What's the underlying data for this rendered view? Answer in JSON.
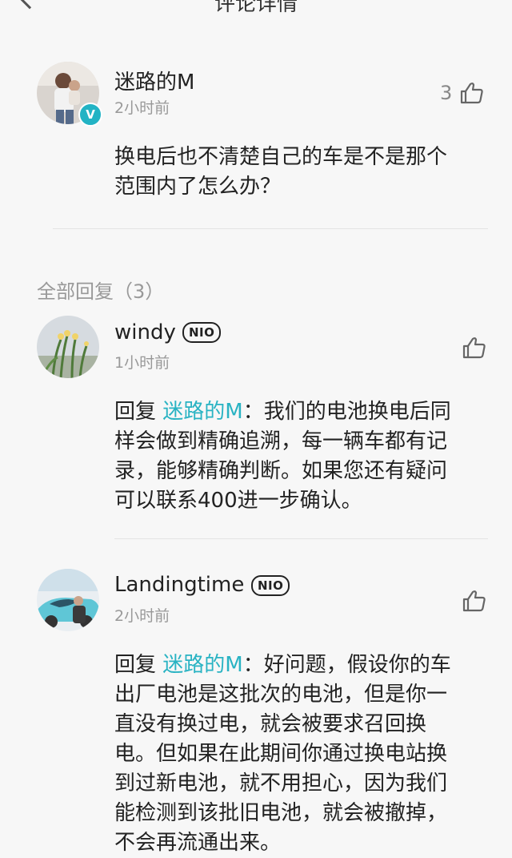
{
  "header": {
    "title": "评论详情"
  },
  "main_comment": {
    "username": "迷路的M",
    "time": "2小时前",
    "like_count": "3",
    "content": "换电后也不清楚自己的车是不是那个\n范围内了怎么办？",
    "verified_badge": "V"
  },
  "replies_section": {
    "label": "全部回复（3）"
  },
  "replies": [
    {
      "username": "windy",
      "badge": "NIO",
      "time": "1小时前",
      "reply_prefix": "回复 ",
      "reply_to": "迷路的M",
      "content": "：我们的电池换电后同\n样会做到精确追溯，每一辆车都有记\n录，能够精确判断。如果您还有疑问\n可以联系400进一步确认。"
    },
    {
      "username": "Landingtime",
      "badge": "NIO",
      "time": "2小时前",
      "reply_prefix": "回复 ",
      "reply_to": "迷路的M",
      "content": "：好问题，假设你的车\n出厂电池是这批次的电池，但是你一\n直没有换过电，就会被要求召回换\n电。但如果在此期间你通过换电站换\n到过新电池，就不用担心，因为我们\n能检测到该批旧电池，就会被撤掉，\n不会再流通出来。"
    }
  ],
  "colors": {
    "accent": "#29b3c3",
    "background": "#f7f7f7",
    "muted_text": "#999999"
  }
}
